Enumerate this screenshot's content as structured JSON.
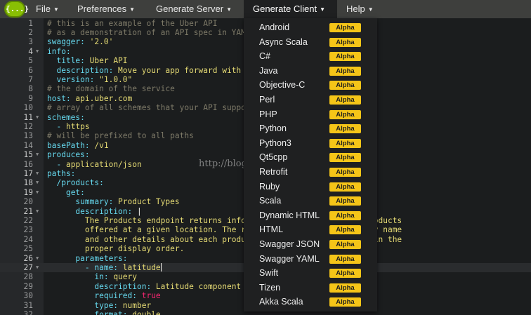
{
  "logo_text": "{...}",
  "menu": [
    "File",
    "Preferences",
    "Generate Server",
    "Generate Client",
    "Help"
  ],
  "watermark": "http://blog.csdn.net/",
  "dropdown": {
    "badge": "Alpha",
    "items": [
      "Android",
      "Async Scala",
      "C#",
      "Java",
      "Objective-C",
      "Perl",
      "PHP",
      "Python",
      "Python3",
      "Qt5cpp",
      "Retrofit",
      "Ruby",
      "Scala",
      "Dynamic HTML",
      "HTML",
      "Swagger JSON",
      "Swagger YAML",
      "Swift",
      "Tizen",
      "Akka Scala"
    ]
  },
  "editor": {
    "current_line": 27,
    "lines": [
      {
        "n": "1",
        "fold": false,
        "parts": [
          [
            "comment",
            "# this is an example of the Uber API"
          ]
        ]
      },
      {
        "n": "2",
        "fold": false,
        "parts": [
          [
            "comment",
            "# as a demonstration of an API spec in YAML"
          ]
        ]
      },
      {
        "n": "3",
        "fold": false,
        "parts": [
          [
            "key",
            "swagger: "
          ],
          [
            "str",
            "'2.0'"
          ]
        ]
      },
      {
        "n": "4",
        "fold": true,
        "parts": [
          [
            "key",
            "info:"
          ]
        ]
      },
      {
        "n": "5",
        "fold": false,
        "parts": [
          [
            "plain",
            "  "
          ],
          [
            "key",
            "title: "
          ],
          [
            "str",
            "Uber API"
          ]
        ]
      },
      {
        "n": "6",
        "fold": false,
        "parts": [
          [
            "plain",
            "  "
          ],
          [
            "key",
            "description: "
          ],
          [
            "str",
            "Move your app forward with the Uber API"
          ]
        ]
      },
      {
        "n": "7",
        "fold": false,
        "parts": [
          [
            "plain",
            "  "
          ],
          [
            "key",
            "version: "
          ],
          [
            "str",
            "\"1.0.0\""
          ]
        ]
      },
      {
        "n": "8",
        "fold": false,
        "parts": [
          [
            "comment",
            "# the domain of the service"
          ]
        ]
      },
      {
        "n": "9",
        "fold": false,
        "parts": [
          [
            "key",
            "host: "
          ],
          [
            "str",
            "api.uber.com"
          ]
        ]
      },
      {
        "n": "10",
        "fold": false,
        "parts": [
          [
            "comment",
            "# array of all schemes that your API supports"
          ]
        ]
      },
      {
        "n": "11",
        "fold": true,
        "parts": [
          [
            "key",
            "schemes:"
          ]
        ]
      },
      {
        "n": "12",
        "fold": false,
        "parts": [
          [
            "plain",
            "  "
          ],
          [
            "key",
            "- "
          ],
          [
            "str",
            "https"
          ]
        ]
      },
      {
        "n": "13",
        "fold": false,
        "parts": [
          [
            "comment",
            "# will be prefixed to all paths"
          ]
        ]
      },
      {
        "n": "14",
        "fold": false,
        "parts": [
          [
            "key",
            "basePath: "
          ],
          [
            "str",
            "/v1"
          ]
        ]
      },
      {
        "n": "15",
        "fold": true,
        "parts": [
          [
            "key",
            "produces:"
          ]
        ]
      },
      {
        "n": "16",
        "fold": false,
        "parts": [
          [
            "plain",
            "  "
          ],
          [
            "key",
            "- "
          ],
          [
            "str",
            "application/json"
          ]
        ]
      },
      {
        "n": "17",
        "fold": true,
        "parts": [
          [
            "key",
            "paths:"
          ]
        ]
      },
      {
        "n": "18",
        "fold": true,
        "parts": [
          [
            "plain",
            "  "
          ],
          [
            "key",
            "/products:"
          ]
        ]
      },
      {
        "n": "19",
        "fold": true,
        "parts": [
          [
            "plain",
            "    "
          ],
          [
            "key",
            "get:"
          ]
        ]
      },
      {
        "n": "20",
        "fold": false,
        "parts": [
          [
            "plain",
            "      "
          ],
          [
            "key",
            "summary: "
          ],
          [
            "str",
            "Product Types"
          ]
        ]
      },
      {
        "n": "21",
        "fold": true,
        "parts": [
          [
            "plain",
            "      "
          ],
          [
            "key",
            "description: "
          ],
          [
            "plain",
            "|"
          ]
        ]
      },
      {
        "n": "22",
        "fold": false,
        "parts": [
          [
            "plain",
            "        "
          ],
          [
            "str",
            "The Products endpoint returns information about the *Uber* products"
          ]
        ]
      },
      {
        "n": "23",
        "fold": false,
        "parts": [
          [
            "plain",
            "        "
          ],
          [
            "str",
            "offered at a given location. The response includes the display name"
          ]
        ]
      },
      {
        "n": "24",
        "fold": false,
        "parts": [
          [
            "plain",
            "        "
          ],
          [
            "str",
            "and other details about each product, and lists the products in the"
          ]
        ]
      },
      {
        "n": "25",
        "fold": false,
        "parts": [
          [
            "plain",
            "        "
          ],
          [
            "str",
            "proper display order."
          ]
        ]
      },
      {
        "n": "26",
        "fold": true,
        "parts": [
          [
            "plain",
            "      "
          ],
          [
            "key",
            "parameters:"
          ]
        ]
      },
      {
        "n": "27",
        "fold": true,
        "parts": [
          [
            "plain",
            "        "
          ],
          [
            "key",
            "- name: "
          ],
          [
            "str",
            "latitude"
          ],
          [
            "cursor",
            ""
          ]
        ]
      },
      {
        "n": "28",
        "fold": false,
        "parts": [
          [
            "plain",
            "          "
          ],
          [
            "key",
            "in: "
          ],
          [
            "str",
            "query"
          ]
        ]
      },
      {
        "n": "29",
        "fold": false,
        "parts": [
          [
            "plain",
            "          "
          ],
          [
            "key",
            "description: "
          ],
          [
            "str",
            "Latitude component of location."
          ]
        ]
      },
      {
        "n": "30",
        "fold": false,
        "parts": [
          [
            "plain",
            "          "
          ],
          [
            "key",
            "required: "
          ],
          [
            "bool",
            "true"
          ]
        ]
      },
      {
        "n": "31",
        "fold": false,
        "parts": [
          [
            "plain",
            "          "
          ],
          [
            "key",
            "type: "
          ],
          [
            "str",
            "number"
          ]
        ]
      },
      {
        "n": "32",
        "fold": false,
        "parts": [
          [
            "plain",
            "          "
          ],
          [
            "key",
            "format: "
          ],
          [
            "str",
            "double"
          ]
        ]
      }
    ]
  }
}
